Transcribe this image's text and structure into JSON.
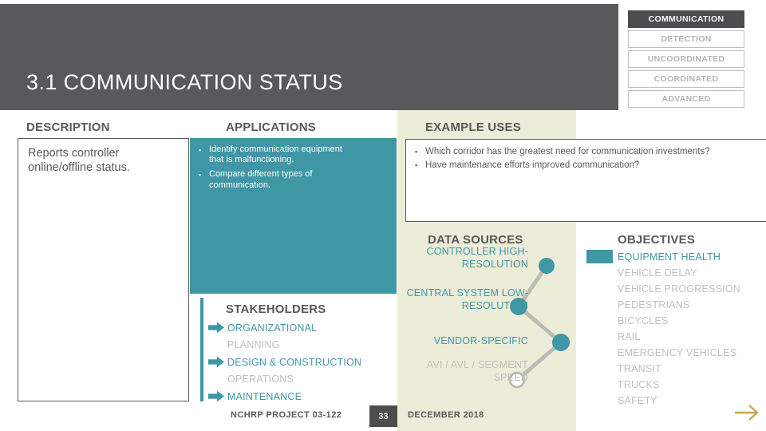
{
  "header": {
    "title": "3.1 COMMUNICATION STATUS",
    "maturity_badges": [
      {
        "label": "COMMUNICATION",
        "active": true
      },
      {
        "label": "DETECTION",
        "active": false
      },
      {
        "label": "UNCOORDINATED",
        "active": false
      },
      {
        "label": "COORDINATED",
        "active": false
      },
      {
        "label": "ADVANCED",
        "active": false
      }
    ]
  },
  "sections": {
    "description_heading": "DESCRIPTION",
    "applications_heading": "APPLICATIONS",
    "example_uses_heading": "EXAMPLE USES",
    "stakeholders_heading": "STAKEHOLDERS",
    "data_sources_heading": "DATA SOURCES",
    "objectives_heading": "OBJECTIVES"
  },
  "description": {
    "text": "Reports controller online/offline status."
  },
  "applications": {
    "bullet_glyph": "▪",
    "items": [
      "Identify communication equipment that is malfunctioning.",
      "Compare different types of communication."
    ]
  },
  "example_uses": {
    "bullet_glyph": "▪",
    "items": [
      "Which corridor has the greatest need for communication investments?",
      "Have maintenance efforts improved communication?"
    ]
  },
  "stakeholders": {
    "items": [
      {
        "label": "ORGANIZATIONAL",
        "active": true
      },
      {
        "label": "PLANNING",
        "active": false
      },
      {
        "label": "DESIGN & CONSTRUCTION",
        "active": true
      },
      {
        "label": "OPERATIONS",
        "active": false
      },
      {
        "label": "MAINTENANCE",
        "active": true
      }
    ]
  },
  "data_sources": {
    "items": [
      {
        "label": "CONTROLLER HIGH-RESOLUTION",
        "active": true
      },
      {
        "label": "CENTRAL SYSTEM LOW-RESOLUTION",
        "active": true
      },
      {
        "label": "VENDOR-SPECIFIC",
        "active": true
      },
      {
        "label": "AVI / AVL / SEGMENT SPEED",
        "active": false
      }
    ]
  },
  "objectives": {
    "items": [
      {
        "label": "EQUIPMENT HEALTH",
        "active": true
      },
      {
        "label": "VEHICLE DELAY",
        "active": false
      },
      {
        "label": "VEHICLE PROGRESSION",
        "active": false
      },
      {
        "label": "PEDESTRIANS",
        "active": false
      },
      {
        "label": "BICYCLES",
        "active": false
      },
      {
        "label": "RAIL",
        "active": false
      },
      {
        "label": "EMERGENCY VEHICLES",
        "active": false
      },
      {
        "label": "TRANSIT",
        "active": false
      },
      {
        "label": "TRUCKS",
        "active": false
      },
      {
        "label": "SAFETY",
        "active": false
      }
    ]
  },
  "footer": {
    "project": "NCHRP PROJECT 03-122",
    "page_number": "33",
    "date": "DECEMBER 2018",
    "next_icon": "arrow-right-icon"
  },
  "colors": {
    "header_gray": "#58595b",
    "teal": "#3f97a5",
    "cream": "#ecedd8",
    "inactive_gray": "#bfbfbf",
    "connector_gray": "#bcbcb4",
    "gold": "#c8a849"
  }
}
